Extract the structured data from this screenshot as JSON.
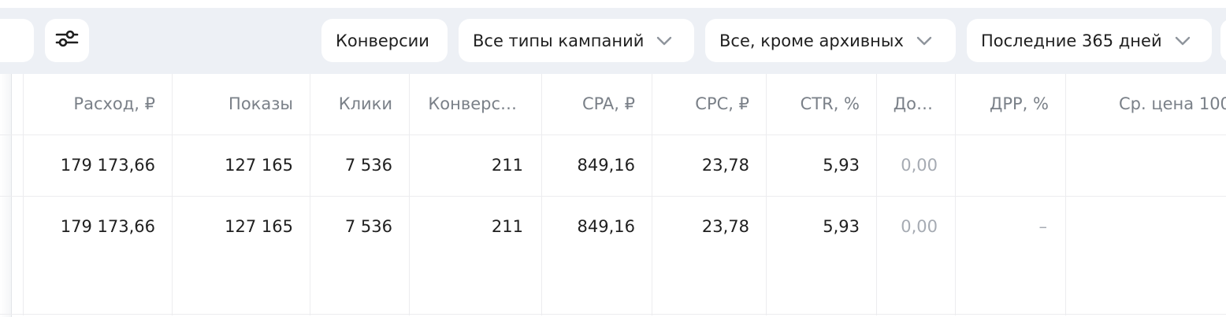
{
  "toolbar": {
    "conversions": "Конверсии",
    "campaign_types": "Все типы кампаний",
    "status_filter": "Все, кроме архивных",
    "period": "Последние 365 дней"
  },
  "table": {
    "headers": [
      "Расход, ₽",
      "Показы",
      "Клики",
      "Конверс…",
      "CPA, ₽",
      "CPC, ₽",
      "CTR, %",
      "До…",
      "ДРР, %",
      "Ср. цена 100"
    ],
    "rows": [
      [
        "179 173,66",
        "127 165",
        "7 536",
        "211",
        "849,16",
        "23,78",
        "5,93",
        "0,00",
        "",
        ""
      ],
      [
        "179 173,66",
        "127 165",
        "7 536",
        "211",
        "849,16",
        "23,78",
        "5,93",
        "0,00",
        "–",
        ""
      ]
    ]
  },
  "colors": {
    "toolbar_band": "#edf0f5",
    "header_text": "#7a8088",
    "muted_text": "#a6abb3",
    "grid_line": "#ececef"
  }
}
